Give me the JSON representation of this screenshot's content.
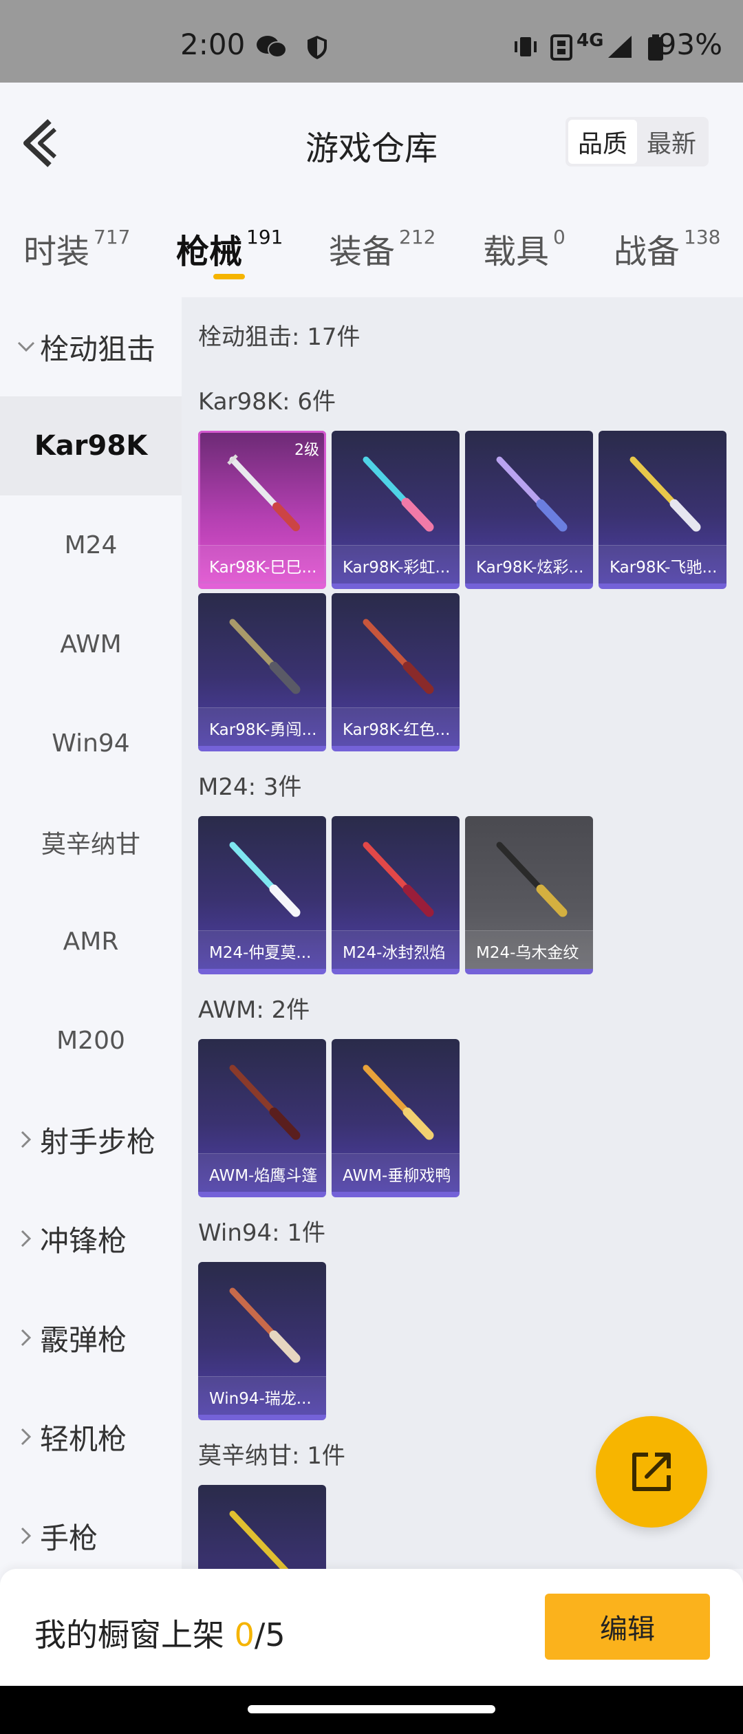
{
  "status_bar": {
    "time": "2:00",
    "network": "4G",
    "battery": "93%"
  },
  "header": {
    "title": "游戏仓库",
    "sort_options": [
      "品质",
      "最新"
    ],
    "sort_active": 0
  },
  "tabs": [
    {
      "label": "时装",
      "count": "717"
    },
    {
      "label": "枪械",
      "count": "191"
    },
    {
      "label": "装备",
      "count": "212"
    },
    {
      "label": "载具",
      "count": "0"
    },
    {
      "label": "战备",
      "count": "138"
    }
  ],
  "active_tab": 1,
  "sidebar": {
    "expanded_category": "栓动狙击",
    "sub_items": [
      "Kar98K",
      "M24",
      "AWM",
      "Win94",
      "莫辛纳甘",
      "AMR",
      "M200"
    ],
    "active_sub": 0,
    "collapsed_categories": [
      "射手步枪",
      "冲锋枪",
      "霰弹枪",
      "轻机枪",
      "手枪"
    ]
  },
  "content": {
    "summary": "栓动狙击: 17件",
    "sections": [
      {
        "title": "Kar98K: 6件",
        "items": [
          {
            "name": "Kar98K-巳巳...",
            "level": "2级",
            "rarity": "pink"
          },
          {
            "name": "Kar98K-彩虹...",
            "level": "",
            "rarity": "purple"
          },
          {
            "name": "Kar98K-炫彩...",
            "level": "",
            "rarity": "purple"
          },
          {
            "name": "Kar98K-飞驰...",
            "level": "",
            "rarity": "purple"
          },
          {
            "name": "Kar98K-勇闯...",
            "level": "",
            "rarity": "purple"
          },
          {
            "name": "Kar98K-红色...",
            "level": "",
            "rarity": "purple"
          }
        ]
      },
      {
        "title": "M24: 3件",
        "items": [
          {
            "name": "M24-仲夏莫...",
            "level": "",
            "rarity": "purple"
          },
          {
            "name": "M24-冰封烈焰",
            "level": "",
            "rarity": "purple"
          },
          {
            "name": "M24-乌木金纹",
            "level": "",
            "rarity": "gray"
          }
        ]
      },
      {
        "title": "AWM: 2件",
        "items": [
          {
            "name": "AWM-焰鹰斗篷",
            "level": "",
            "rarity": "purple"
          },
          {
            "name": "AWM-垂柳戏鸭",
            "level": "",
            "rarity": "purple"
          }
        ]
      },
      {
        "title": "Win94: 1件",
        "items": [
          {
            "name": "Win94-瑞龙...",
            "level": "",
            "rarity": "purple"
          }
        ]
      },
      {
        "title": "莫辛纳甘: 1件",
        "items": []
      }
    ]
  },
  "bottom_bar": {
    "label": "我的橱窗上架 ",
    "count": "0",
    "total": "/5",
    "edit_label": "编辑"
  },
  "colors": {
    "accent": "#f5b400",
    "rare_purple": "#7462d8",
    "rare_pink": "#e052d0"
  }
}
